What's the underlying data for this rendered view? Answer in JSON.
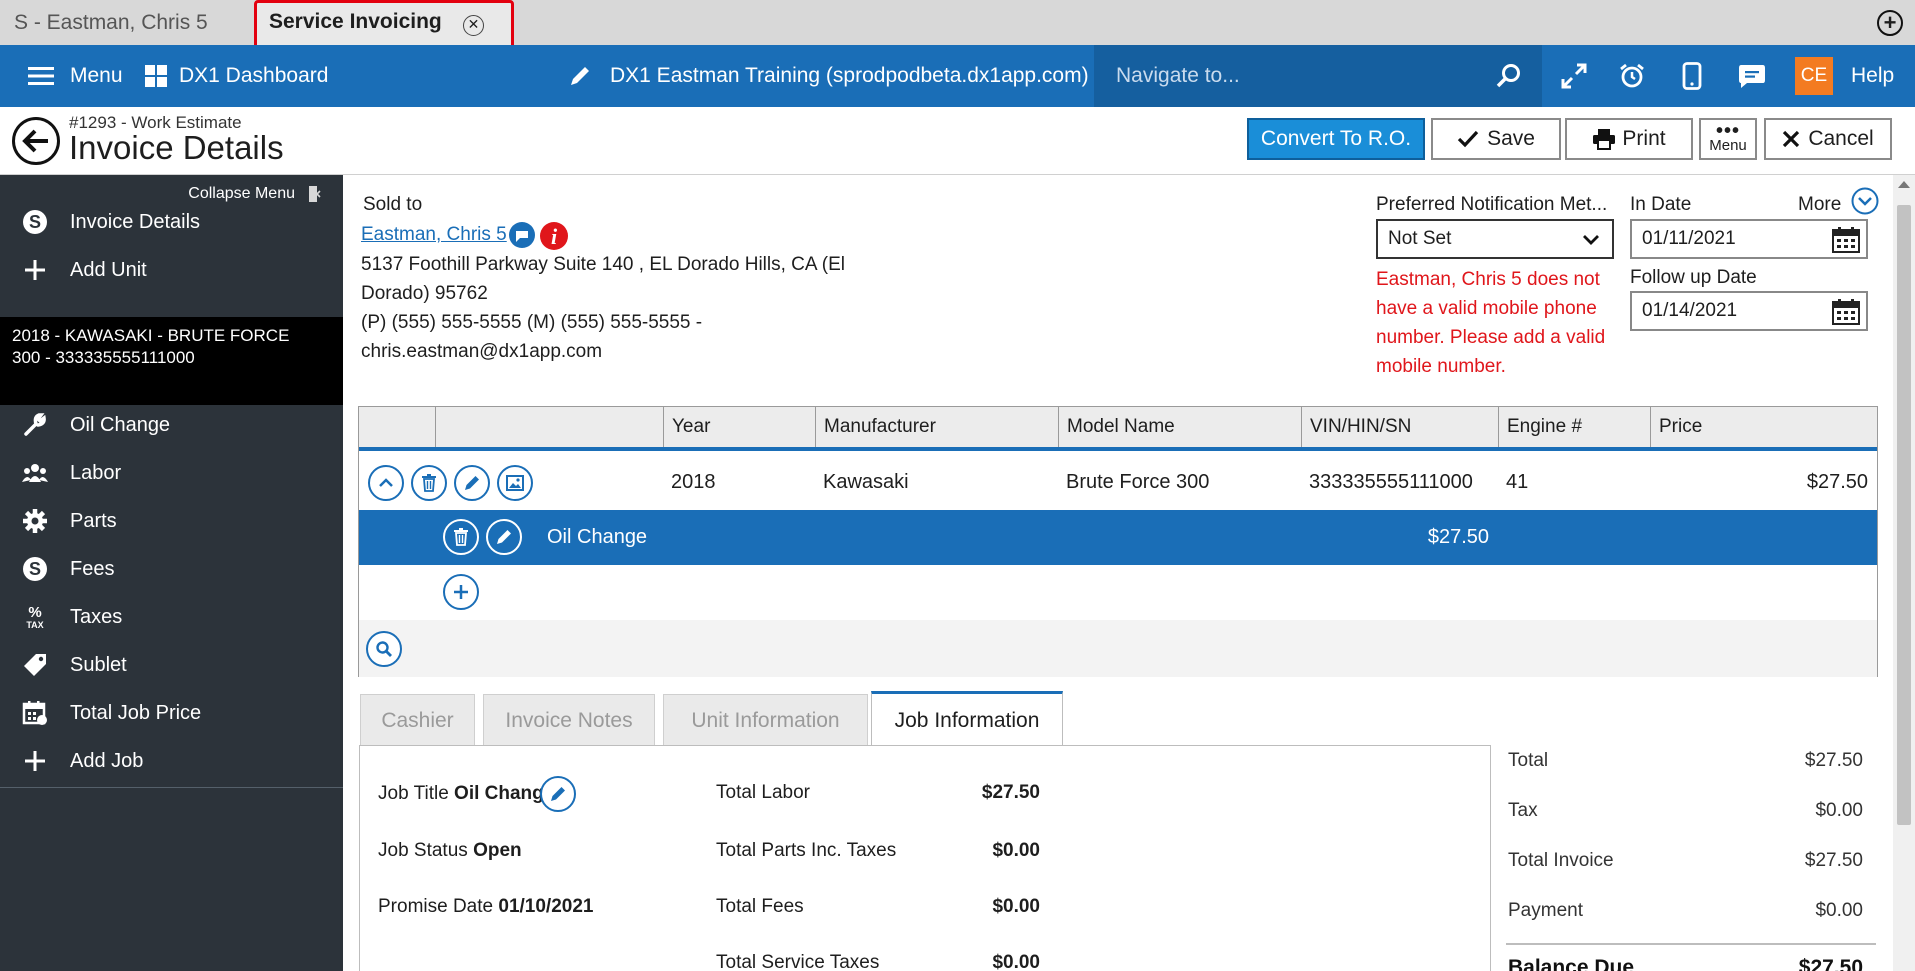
{
  "tabs": {
    "inactive_label": "S - Eastman, Chris 5",
    "active_label": "Service Invoicing"
  },
  "nav": {
    "menu": "Menu",
    "dashboard": "DX1 Dashboard",
    "dealership": "DX1 Eastman Training (sprodpodbeta.dx1app.com)",
    "search_placeholder": "Navigate to...",
    "user_initials": "CE",
    "help": "Help"
  },
  "header": {
    "subtitle": "#1293 - Work Estimate",
    "title": "Invoice Details",
    "convert": "Convert To R.O.",
    "save": "Save",
    "print": "Print",
    "menu": "Menu",
    "cancel": "Cancel"
  },
  "sidebar": {
    "collapse": "Collapse Menu",
    "items": [
      {
        "label": "Invoice Details",
        "icon": "dollar-circle-icon"
      },
      {
        "label": "Add Unit",
        "icon": "plus-icon"
      }
    ],
    "unit_line1": "2018 - KAWASAKI - BRUTE FORCE",
    "unit_line2": "300 - 333335555111000",
    "job_items": [
      {
        "label": "Oil Change",
        "icon": "wrench-icon"
      },
      {
        "label": "Labor",
        "icon": "people-icon"
      },
      {
        "label": "Parts",
        "icon": "gear-icon"
      },
      {
        "label": "Fees",
        "icon": "dollar-circle-icon"
      },
      {
        "label": "Taxes",
        "icon": "percent-tax-icon"
      },
      {
        "label": "Sublet",
        "icon": "tag-icon"
      },
      {
        "label": "Total Job Price",
        "icon": "calendar-price-icon"
      },
      {
        "label": "Add Job",
        "icon": "plus-icon"
      }
    ]
  },
  "customer": {
    "sold_to_label": "Sold to",
    "name": "Eastman, Chris 5",
    "address_line1": "5137 Foothill Parkway Suite 140 , EL Dorado Hills, CA (El",
    "address_line2": "Dorado) 95762",
    "phones": "(P) (555) 555-5555 (M) (555) 555-5555 -",
    "email": "chris.eastman@dx1app.com"
  },
  "notification": {
    "label": "Preferred Notification Met...",
    "value": "Not Set",
    "warning_lines": [
      "Eastman, Chris 5 does not",
      "have a valid mobile phone",
      "number. Please add a valid",
      "mobile number."
    ]
  },
  "dates": {
    "in_label": "In Date",
    "in_value": "01/11/2021",
    "followup_label": "Follow up Date",
    "followup_value": "01/14/2021",
    "more": "More"
  },
  "grid": {
    "headers": [
      "Year",
      "Manufacturer",
      "Model Name",
      "VIN/HIN/SN",
      "Engine #",
      "Price"
    ],
    "unit": {
      "year": "2018",
      "manufacturer": "Kawasaki",
      "model": "Brute Force 300",
      "vin": "333335555111000",
      "engine": "41",
      "price": "$27.50"
    },
    "job": {
      "name": "Oil Change",
      "price": "$27.50"
    }
  },
  "subtabs": [
    "Cashier",
    "Invoice Notes",
    "Unit Information",
    "Job Information"
  ],
  "job_info": {
    "title_label": "Job Title",
    "title_value": "Oil Change",
    "status_label": "Job Status",
    "status_value": "Open",
    "promise_label": "Promise Date",
    "promise_value": "01/10/2021",
    "labor_label": "Total Labor",
    "labor_value": "$27.50",
    "parts_label": "Total Parts Inc. Taxes",
    "parts_value": "$0.00",
    "fees_label": "Total Fees",
    "fees_value": "$0.00",
    "service_tax_label": "Total Service Taxes",
    "service_tax_value": "$0.00"
  },
  "totals": {
    "total_label": "Total",
    "total_value": "$27.50",
    "tax_label": "Tax",
    "tax_value": "$0.00",
    "invoice_label": "Total Invoice",
    "invoice_value": "$27.50",
    "payment_label": "Payment",
    "payment_value": "$0.00",
    "balance_label": "Balance Due",
    "balance_value": "$27.50"
  },
  "colors": {
    "brand_blue": "#1a6eb7",
    "sidebar": "#2c333a",
    "warning": "#e0161b",
    "user_badge": "#f37b21"
  }
}
